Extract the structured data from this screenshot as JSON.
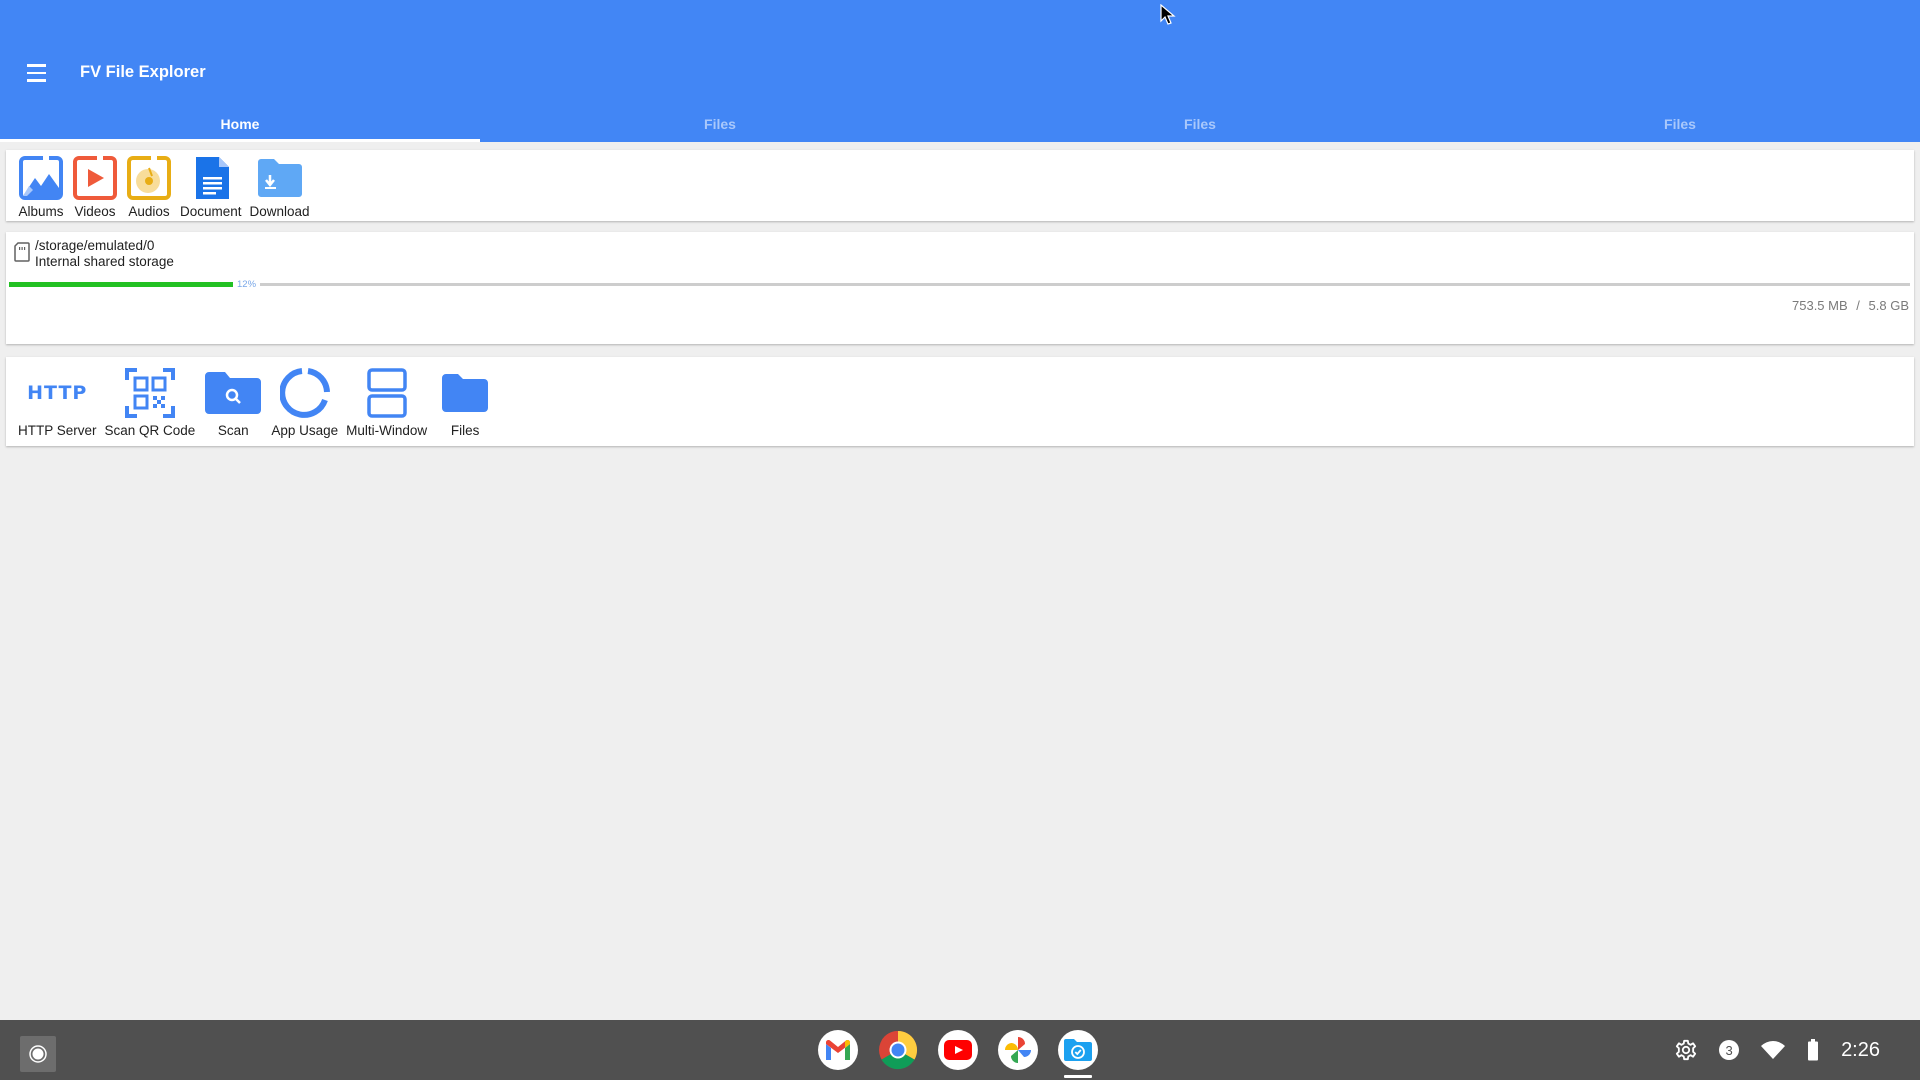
{
  "app": {
    "title": "FV File Explorer",
    "menu_icon": "hamburger-menu-icon",
    "accent_color": "#4286f5"
  },
  "tabs": [
    {
      "label": "Home",
      "active": true
    },
    {
      "label": "Files",
      "active": false
    },
    {
      "label": "Files",
      "active": false
    },
    {
      "label": "Files",
      "active": false
    }
  ],
  "categories": [
    {
      "label": "Albums",
      "icon": "image-icon"
    },
    {
      "label": "Videos",
      "icon": "video-icon"
    },
    {
      "label": "Audios",
      "icon": "audio-icon"
    },
    {
      "label": "Document",
      "icon": "document-icon"
    },
    {
      "label": "Download",
      "icon": "download-folder-icon"
    }
  ],
  "storage": {
    "path": "/storage/emulated/0",
    "name": "Internal shared storage",
    "percent_used": 12,
    "percent_label": "12%",
    "used": "753.5 MB",
    "separator": "/",
    "total": "5.8 GB",
    "usage_label": "753.5 MB  /  5.8 GB",
    "bar_color": "#22c122"
  },
  "tools": [
    {
      "label": "HTTP Server",
      "icon": "http-icon",
      "icon_text": "HTTP"
    },
    {
      "label": "Scan QR Code",
      "icon": "qr-code-icon"
    },
    {
      "label": "Scan",
      "icon": "folder-search-icon"
    },
    {
      "label": "App Usage",
      "icon": "donut-chart-icon"
    },
    {
      "label": "Multi-Window",
      "icon": "multi-window-icon"
    },
    {
      "label": "Files",
      "icon": "folder-icon"
    }
  ],
  "shelf": {
    "apps": [
      {
        "name": "Gmail",
        "icon": "gmail-icon"
      },
      {
        "name": "Chrome",
        "icon": "chrome-icon"
      },
      {
        "name": "YouTube",
        "icon": "youtube-icon"
      },
      {
        "name": "Photos",
        "icon": "photos-icon"
      },
      {
        "name": "FV File Explorer",
        "icon": "file-explorer-icon",
        "active": true
      }
    ],
    "notification_count": "3",
    "time": "2:26"
  }
}
